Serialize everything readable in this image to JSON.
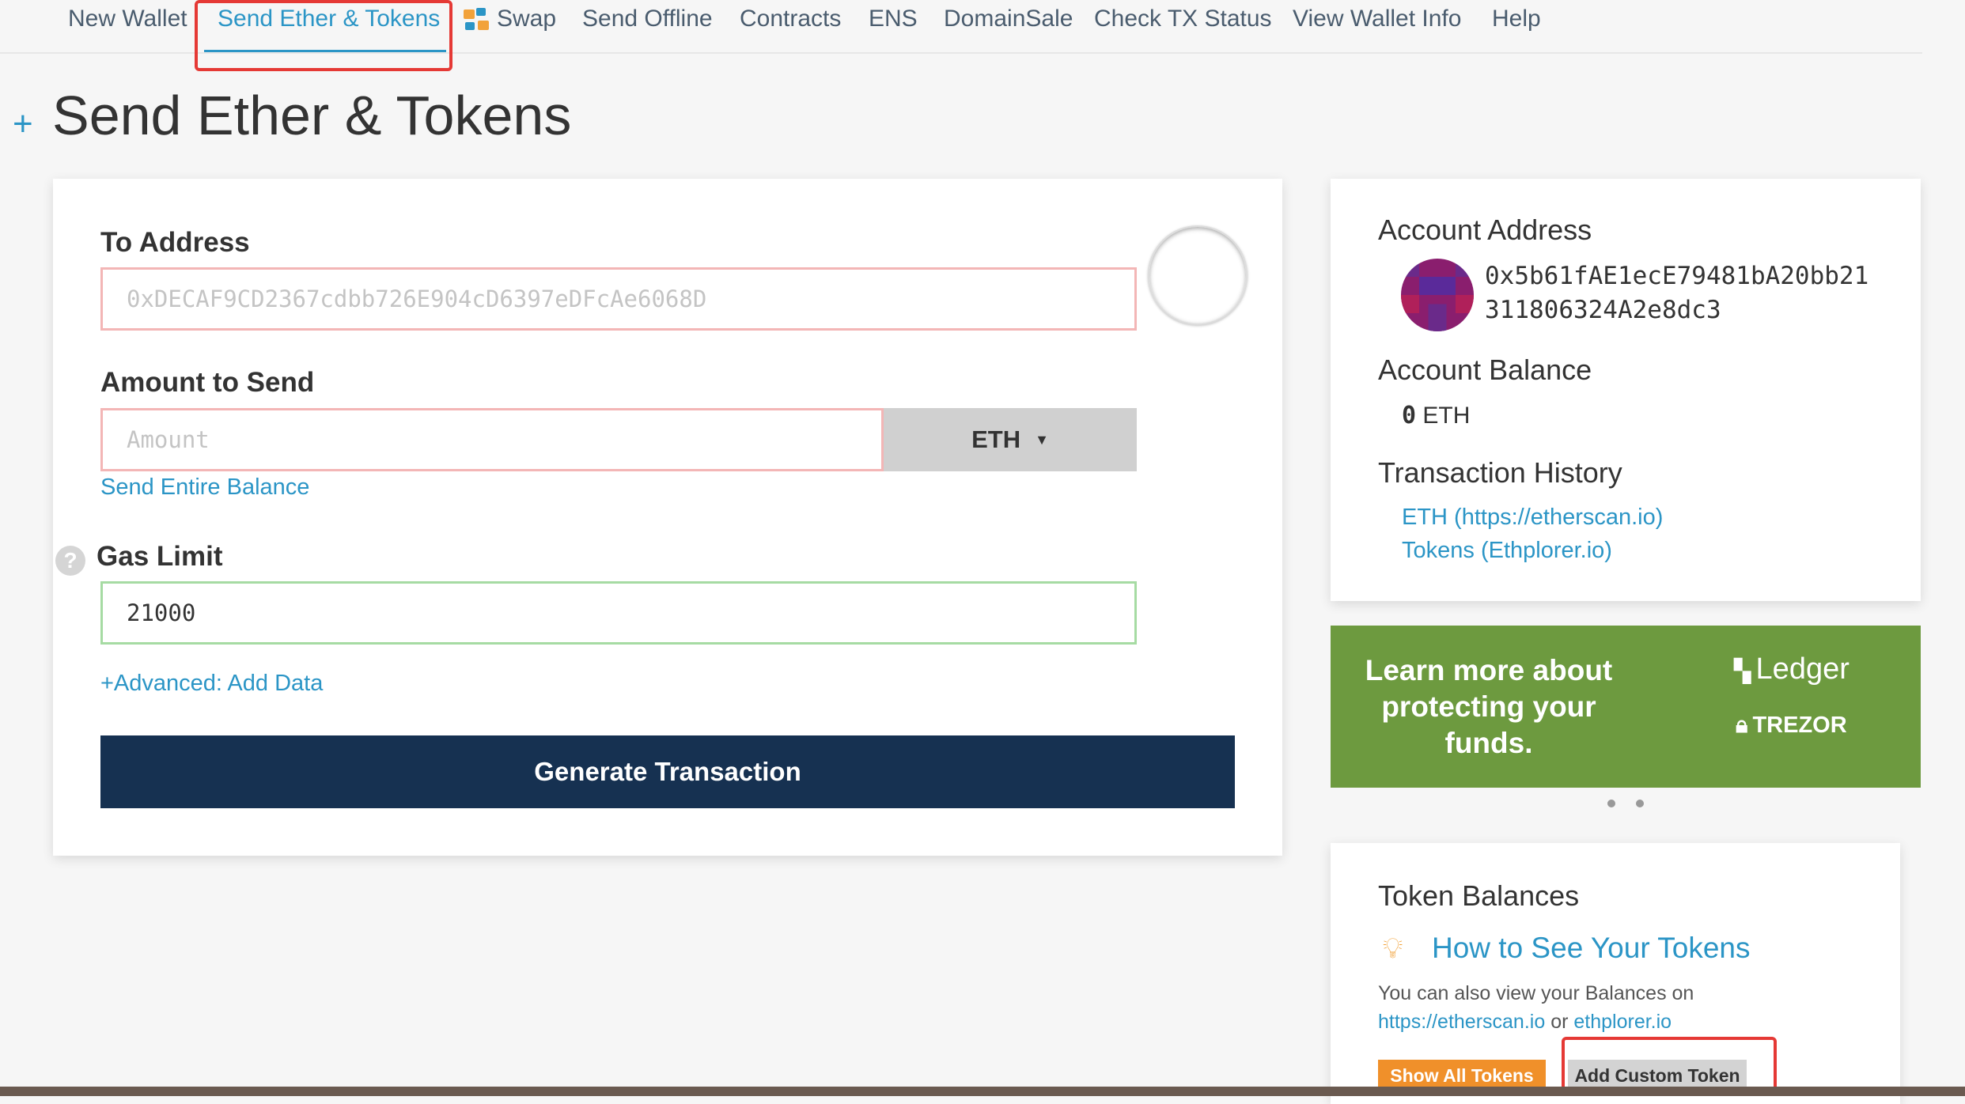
{
  "nav": {
    "items": [
      {
        "label": "New Wallet"
      },
      {
        "label": "Send Ether & Tokens"
      },
      {
        "label": "Swap"
      },
      {
        "label": "Send Offline"
      },
      {
        "label": "Contracts"
      },
      {
        "label": "ENS"
      },
      {
        "label": "DomainSale"
      },
      {
        "label": "Check TX Status"
      },
      {
        "label": "View Wallet Info"
      },
      {
        "label": "Help"
      }
    ],
    "active_index": 1
  },
  "page": {
    "title": "Send Ether & Tokens",
    "plus_icon": "+"
  },
  "form": {
    "to_address": {
      "label": "To Address",
      "placeholder": "0xDECAF9CD2367cdbb726E904cD6397eDFcAe6068D",
      "value": ""
    },
    "amount": {
      "label": "Amount to Send",
      "placeholder": "Amount",
      "value": "",
      "currency": "ETH",
      "send_entire_balance": "Send Entire Balance"
    },
    "gas_limit": {
      "label": "Gas Limit",
      "value": "21000",
      "help_icon": "?"
    },
    "advanced_link": "+Advanced: Add Data",
    "generate_button": "Generate Transaction"
  },
  "account": {
    "address_heading": "Account Address",
    "address_line1": "0x5b61fAE1ecE79481bA20bb21",
    "address_line2": "311806324A2e8dc3",
    "balance_heading": "Account Balance",
    "balance_value": "0",
    "balance_unit": "ETH",
    "history_heading": "Transaction History",
    "history_eth_link": "ETH (https://etherscan.io)",
    "history_tokens_link": "Tokens (Ethplorer.io)"
  },
  "promo": {
    "text": "Learn more about protecting your funds.",
    "ledger_label": "Ledger",
    "trezor_label": "TREZOR",
    "bg_color": "#6d9a3f"
  },
  "tokens": {
    "heading": "Token Balances",
    "how_to_link": "How to See Your Tokens",
    "info_prefix": "You can also view your Balances on",
    "etherscan_link": "https://etherscan.io",
    "or_text": "or",
    "ethplorer_link": "ethplorer.io",
    "show_all_button": "Show All Tokens",
    "add_custom_button": "Add Custom Token"
  },
  "colors": {
    "accent": "#2b95c6",
    "primary_button": "#163151",
    "highlight_box": "#e53935",
    "show_all_button": "#f0902a"
  }
}
